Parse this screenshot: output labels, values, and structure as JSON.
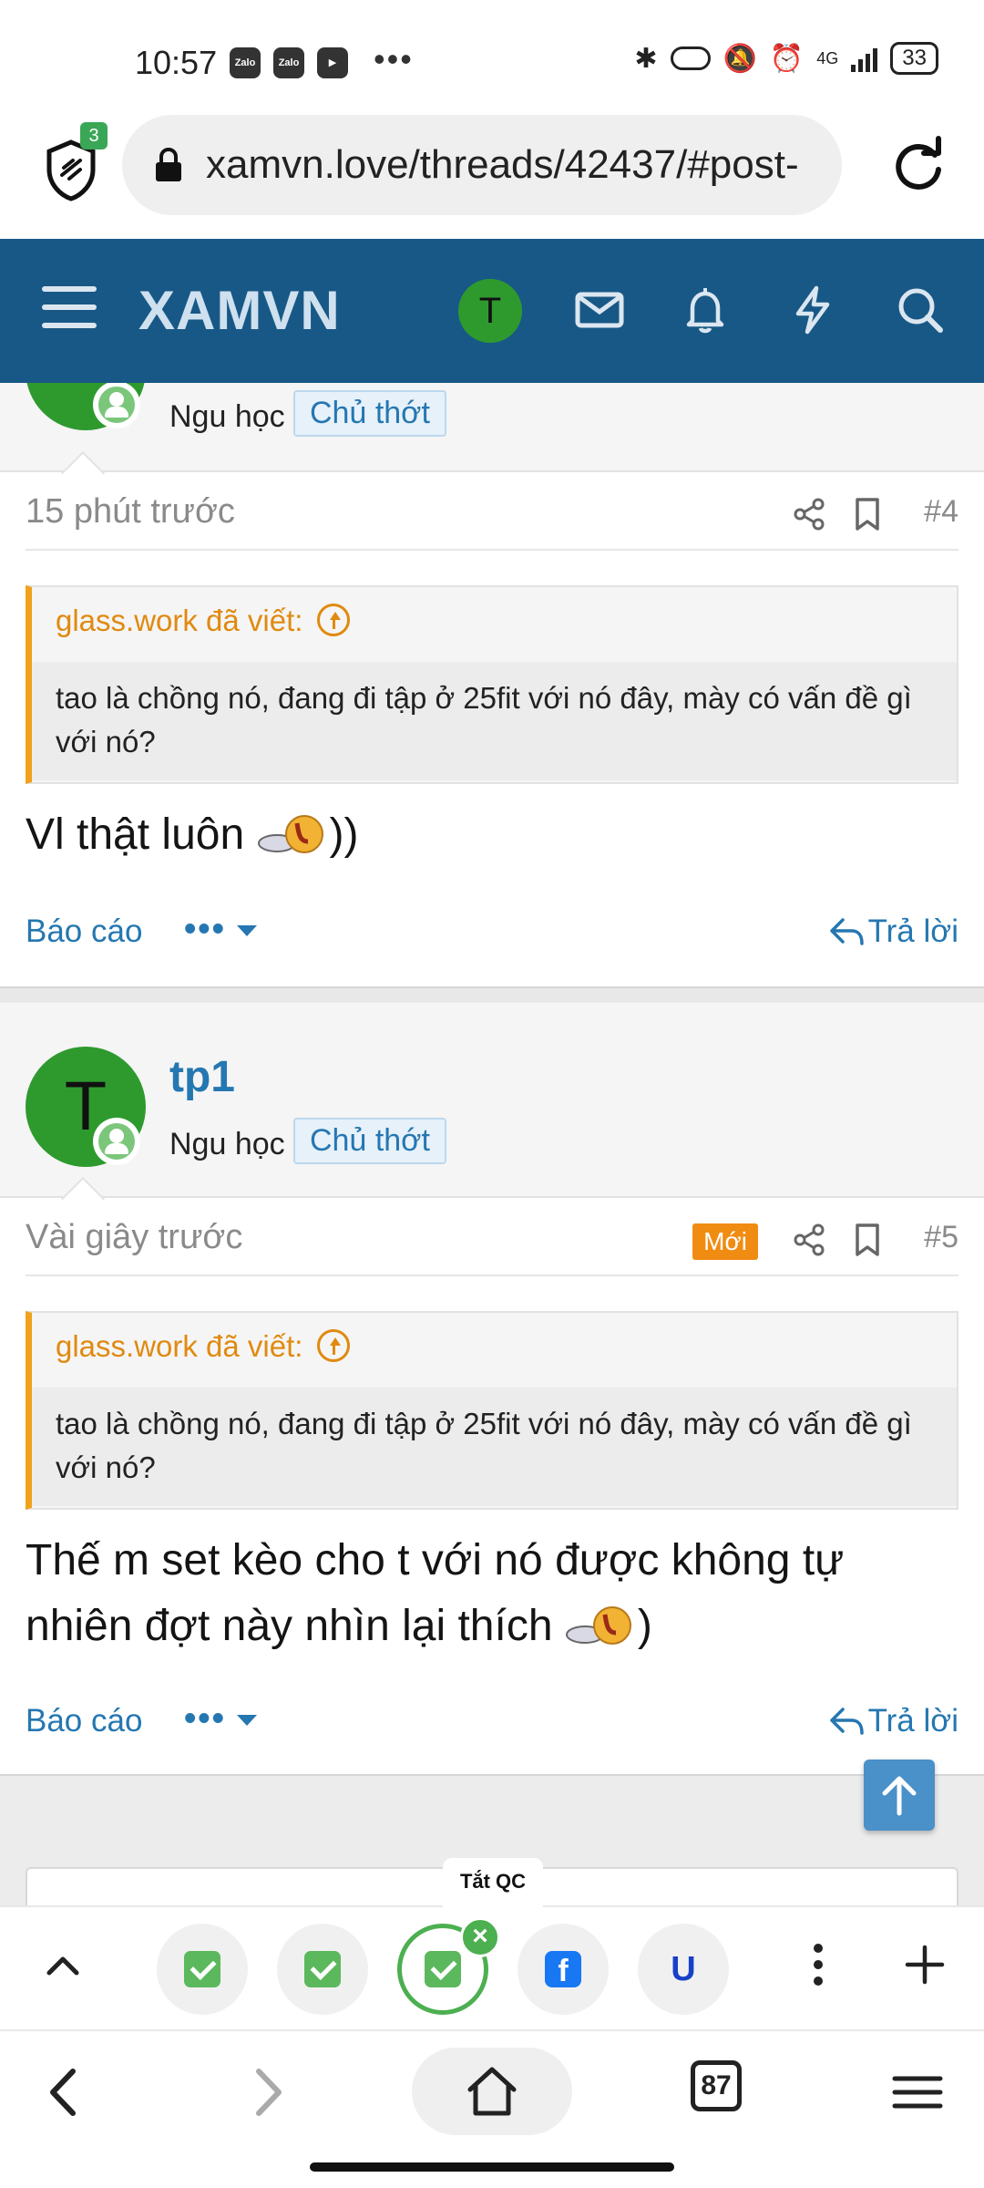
{
  "status_bar": {
    "time": "10:57",
    "apps": [
      "Zalo",
      "Zalo",
      "▶"
    ],
    "network": "4G",
    "battery": "33"
  },
  "browser": {
    "url": "xamvn.love/threads/42437/#post-",
    "shield_badge": "3",
    "icons": [
      "shield-icon",
      "lock-icon",
      "reload-icon"
    ]
  },
  "site_header": {
    "logo": "XAMVN",
    "user_initial": "T",
    "icons": [
      "hamburger-icon",
      "mail-icon",
      "bell-icon",
      "lightning-icon",
      "search-icon"
    ]
  },
  "posts": [
    {
      "user_title": "Ngu học",
      "user_badge": "Chủ thớt",
      "time": "15 phút trước",
      "number": "#4",
      "quote_author": "glass.work đã viết:",
      "quote_text": "tao là chồng nó, đang đi tập ở 25fit với nó đây, mày có vấn đề gì với nó?",
      "text": "Vl thật luôn",
      "text_suffix": "))",
      "report": "Báo cáo",
      "reply": "Trả lời"
    },
    {
      "user_initial": "T",
      "user_name": "tp1",
      "user_title": "Ngu học",
      "user_badge": "Chủ thớt",
      "time": "Vài giây trước",
      "new_badge": "Mới",
      "number": "#5",
      "quote_author": "glass.work đã viết:",
      "quote_text": "tao là chồng nó, đang đi tập ở 25fit với nó đây, mày có vấn đề gì với nó?",
      "text": "Thế m set kèo cho t với nó được không tự nhiên đợt này nhìn lại thích",
      "text_suffix": ")",
      "report": "Báo cáo",
      "reply": "Trả lời"
    }
  ],
  "more_label": "•••",
  "quick_bar": {
    "ad_label": "Tắt QC",
    "items": [
      "check-icon",
      "check-icon",
      "check-icon",
      "facebook-icon",
      "u-icon"
    ]
  },
  "nav": {
    "tab_count": "87"
  },
  "colors": {
    "header_bg": "#185886",
    "link": "#2577b1",
    "quote_accent": "#f0a21b",
    "new_badge": "#f08c12",
    "avatar": "#2e9a2e"
  }
}
